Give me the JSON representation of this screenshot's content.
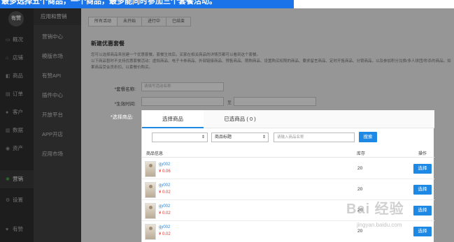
{
  "caption": "最多选择五个商品，一个商品，最多能同时参加三个套餐活动。",
  "sidebar": {
    "logo": "有赞",
    "items": [
      {
        "label": "概况",
        "icon": "monitor-icon"
      },
      {
        "label": "店铺",
        "icon": "store-icon"
      },
      {
        "label": "商品",
        "icon": "tag-icon"
      },
      {
        "label": "订单",
        "icon": "order-icon"
      },
      {
        "label": "客户",
        "icon": "user-icon"
      },
      {
        "label": "数据",
        "icon": "chart-icon"
      },
      {
        "label": "资产",
        "icon": "money-icon"
      },
      {
        "label": "营销",
        "icon": "puzzle-icon",
        "active": true
      },
      {
        "label": "设置",
        "icon": "gear-icon"
      },
      {
        "label": "有赞",
        "icon": "like-icon"
      }
    ]
  },
  "subnav": {
    "header": "应用和营销",
    "items": [
      "营销中心",
      "模版市场",
      "有赞API",
      "插件中心",
      "开放平台",
      "APP开店",
      "应用市场"
    ]
  },
  "main": {
    "tabs": [
      "所有活动",
      "未开始",
      "进行中",
      "已结束"
    ],
    "title": "新建优惠套餐",
    "notes": [
      "您可以选择商品来创建一个优惠套餐。套餐生效后，买家在相关商品的详情页都可以看到这个套餐。",
      "以下商品暂时不支持优惠套餐活动：虚拟商品、电子卡券商品、外部链接商品、预售商品、限购商品、设置购买权限的商品、要求留言商品、定时开售商品、分销商品，以及参加积分兑换/多人拼团/秒杀的商品。如果商品受会员折扣，以套餐价购买。"
    ],
    "name_label": "*套餐名称:",
    "name_placeholder": "请填写活动名称",
    "time_label": "*生效时间:",
    "time_to": "至",
    "goods_label": "*选择商品:"
  },
  "modal": {
    "tab_select": "选择商品",
    "tab_selected": "已选商品 ( 0 )",
    "filter_category": "",
    "filter_field": "商品标题",
    "search_placeholder": "请输入商品名称",
    "search_button": "搜索",
    "columns": {
      "info": "商品信息",
      "stock": "库存",
      "action": "操作"
    },
    "rows": [
      {
        "name": "gy002",
        "price": "¥ 0.06",
        "stock": "20",
        "action": "选择"
      },
      {
        "name": "gy002",
        "price": "¥ 0.02",
        "stock": "20",
        "action": "选择"
      },
      {
        "name": "gy002",
        "price": "¥ 0.02",
        "stock": "20",
        "action": "选择"
      },
      {
        "name": "gy002",
        "price": "¥ 0.02",
        "stock": "20",
        "action": "选择"
      }
    ]
  },
  "watermark": {
    "main": "Bai 经验",
    "sub": "jingyan.baidu.com"
  }
}
